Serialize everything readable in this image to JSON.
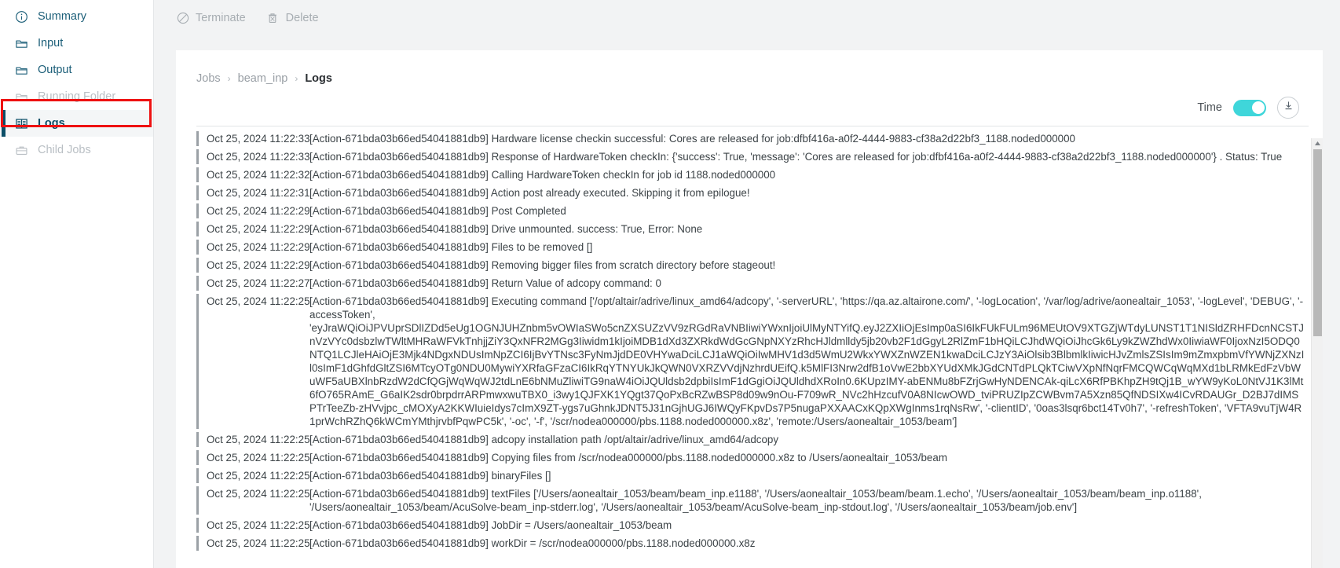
{
  "sidebar": {
    "items": [
      {
        "label": "Summary",
        "icon": "info-circle-icon",
        "state": "normal",
        "name": "sidebar-item-summary"
      },
      {
        "label": "Input",
        "icon": "folder-icon",
        "state": "normal",
        "name": "sidebar-item-input"
      },
      {
        "label": "Output",
        "icon": "folder-icon",
        "state": "normal",
        "name": "sidebar-item-output"
      },
      {
        "label": "Running Folder",
        "icon": "folder-icon",
        "state": "disabled",
        "name": "sidebar-item-running-folder"
      },
      {
        "label": "Logs",
        "icon": "book-icon",
        "state": "active",
        "name": "sidebar-item-logs"
      },
      {
        "label": "Child Jobs",
        "icon": "briefcase-icon",
        "state": "disabled",
        "name": "sidebar-item-child-jobs"
      }
    ]
  },
  "toolbar": {
    "terminate_label": "Terminate",
    "delete_label": "Delete",
    "terminate_icon": "no-entry-icon",
    "delete_icon": "trash-icon"
  },
  "breadcrumb": {
    "root": "Jobs",
    "job": "beam_inp",
    "current": "Logs",
    "separator": "›"
  },
  "log_controls": {
    "time_label": "Time",
    "time_toggle_on": true,
    "toggle_color": "#3fd6da",
    "download_icon": "download-icon"
  },
  "scrollbar": {
    "up_arrow_icon": "caret-up-icon",
    "thumb_color": "#b8b8b8"
  },
  "logs": [
    {
      "time": "Oct 25, 2024 11:22:33",
      "message": "[Action-671bda03b66ed54041881db9] Hardware license checkin successful: Cores are released for job:dfbf416a-a0f2-4444-9883-cf38a2d22bf3_1188.noded000000",
      "nowrap": true
    },
    {
      "time": "Oct 25, 2024 11:22:33",
      "message": "[Action-671bda03b66ed54041881db9] Response of HardwareToken checkIn: {'success': True, 'message': 'Cores are released for job:dfbf416a-a0f2-4444-9883-cf38a2d22bf3_1188.noded000000'} . Status:  True",
      "nowrap": true
    },
    {
      "time": "Oct 25, 2024 11:22:32",
      "message": "[Action-671bda03b66ed54041881db9] Calling HardwareToken checkIn for job id 1188.noded000000",
      "nowrap": true
    },
    {
      "time": "Oct 25, 2024 11:22:31",
      "message": "[Action-671bda03b66ed54041881db9] Action post already executed. Skipping it from epilogue!",
      "nowrap": true
    },
    {
      "time": "Oct 25, 2024 11:22:29",
      "message": "[Action-671bda03b66ed54041881db9] Post Completed",
      "nowrap": true
    },
    {
      "time": "Oct 25, 2024 11:22:29",
      "message": "[Action-671bda03b66ed54041881db9] Drive unmounted. success: True, Error: None",
      "nowrap": true
    },
    {
      "time": "Oct 25, 2024 11:22:29",
      "message": "[Action-671bda03b66ed54041881db9] Files to be removed []",
      "nowrap": true
    },
    {
      "time": "Oct 25, 2024 11:22:29",
      "message": "[Action-671bda03b66ed54041881db9] Removing bigger files from scratch directory before stageout!",
      "nowrap": true
    },
    {
      "time": "Oct 25, 2024 11:22:27",
      "message": "[Action-671bda03b66ed54041881db9] Return Value of adcopy command: 0",
      "nowrap": true
    },
    {
      "time": "Oct 25, 2024 11:22:25",
      "message": "[Action-671bda03b66ed54041881db9] Executing command ['/opt/altair/adrive/linux_amd64/adcopy', '-serverURL', 'https://qa.az.altairone.com/', '-logLocation', '/var/log/adrive/aonealtair_1053', '-logLevel', 'DEBUG', '-accessToken',\n'eyJraWQiOiJPVUprSDlIZDd5eUg1OGNJUHZnbm5vOWIaSWo5cnZXSUZzVV9zRGdRaVNBIiwiYWxnIjoiUlMyNTYifQ.eyJ2ZXIiOjEsImp0aSI6IkFUkFULm96MEUtOV9XTGZjWTdyLUNST1T1NISldZRHFDcnNCSTJnVzVYc0dsbzlwTWltMHRaWFVkTnhjjZiY3QxNFR2MGg3Iiwidm1kIjoiMDB1dXd3ZXRkdWdGcGNpNXYzRhcHJldmlldy5jb20vb2F1dGgyL2RlZmF1bHQiLCJhdWQiOiJhcGk6Ly9kZWZhdWx0IiwiaWF0IjoxNzI5ODQ0NTQ1LCJleHAiOjE3Mjk4NDgxNDUsImNpZCI6IjBvYTNsc3FyNmJjdDE0VHYwaDciLCJ1aWQiOiIwMHV1d3d5WmU2WkxYWXZnWZEN1kwaDciLCJzY3AiOlsib3BlbmlkIiwicHJvZmlsZSIsIm9mZmxpbmVfYWNjZXNzIl0sImF1dGhfdGltZSI6MTcyOTg0NDU0MywiYXRfaGFzaCI6IkRqYTNYUkJkQWN0VXRZVVdjNzhrdUEifQ.k5MlFI3Nrw2dfB1oVwE2bbXYUdXMkJGdCNTdPLQkTCiwVXpNfNqrFMCQWCqWqMXd1bLRMkEdFzVbWuWF5aUBXlnbRzdW2dCfQGjWqWqWJ2tdLnE6bNMuZliwiTG9naW4iOiJQUldsb2dpbiIsImF1dGgiOiJQUldhdXRoIn0.6KUpzIMY-abENMu8bFZrjGwHyNDENCAk-qiLcX6RfPBKhpZH9tQj1B_wYW9yKoL0NtVJ1K3lMt6fO765RAmE_G6aIK2sdr0brpdrrARPmwxwuTBX0_i3wy1QJFXK1YQgt37QoPxBcRZwBSP8d09w9nOu-F709wR_NVc2hHzcufV0A8NIcwOWD_tviPRUZIpZCWBvm7A5Xzn85QfNDSIXw4ICvRDAUGr_D2BJ7dIMSPTrTeeZb-zHVvjpc_cMOXyA2KKWIuieIdys7cImX9ZT-ygs7uGhnkJDNT5J31nGjhUGJ6IWQyFKpvDs7P5nugaPXXAACxKQpXWgInms1rqNsRw', '-clientID', '0oas3lsqr6bct14Tv0h7', '-refreshToken', 'VFTA9vuTjW4R1prWchRZhQ6kWCmYMthjrvbfPqwPC5k', '-oc', '-f', '/scr/nodea000000/pbs.1188.noded000000.x8z', 'remote:/Users/aonealtair_1053/beam']",
      "nowrap": false
    },
    {
      "time": "Oct 25, 2024 11:22:25",
      "message": "[Action-671bda03b66ed54041881db9] adcopy installation path /opt/altair/adrive/linux_amd64/adcopy",
      "nowrap": true
    },
    {
      "time": "Oct 25, 2024 11:22:25",
      "message": "[Action-671bda03b66ed54041881db9] Copying files from /scr/nodea000000/pbs.1188.noded000000.x8z to /Users/aonealtair_1053/beam",
      "nowrap": true
    },
    {
      "time": "Oct 25, 2024 11:22:25",
      "message": "[Action-671bda03b66ed54041881db9] binaryFiles []",
      "nowrap": true
    },
    {
      "time": "Oct 25, 2024 11:22:25",
      "message": "[Action-671bda03b66ed54041881db9] textFiles ['/Users/aonealtair_1053/beam/beam_inp.e1188', '/Users/aonealtair_1053/beam/beam.1.echo', '/Users/aonealtair_1053/beam/beam_inp.o1188',\n'/Users/aonealtair_1053/beam/AcuSolve-beam_inp-stderr.log', '/Users/aonealtair_1053/beam/AcuSolve-beam_inp-stdout.log', '/Users/aonealtair_1053/beam/job.env']",
      "nowrap": false
    },
    {
      "time": "Oct 25, 2024 11:22:25",
      "message": "[Action-671bda03b66ed54041881db9] JobDir = /Users/aonealtair_1053/beam",
      "nowrap": true
    },
    {
      "time": "Oct 25, 2024 11:22:25",
      "message": "[Action-671bda03b66ed54041881db9] workDir = /scr/nodea000000/pbs.1188.noded000000.x8z",
      "nowrap": true
    }
  ]
}
